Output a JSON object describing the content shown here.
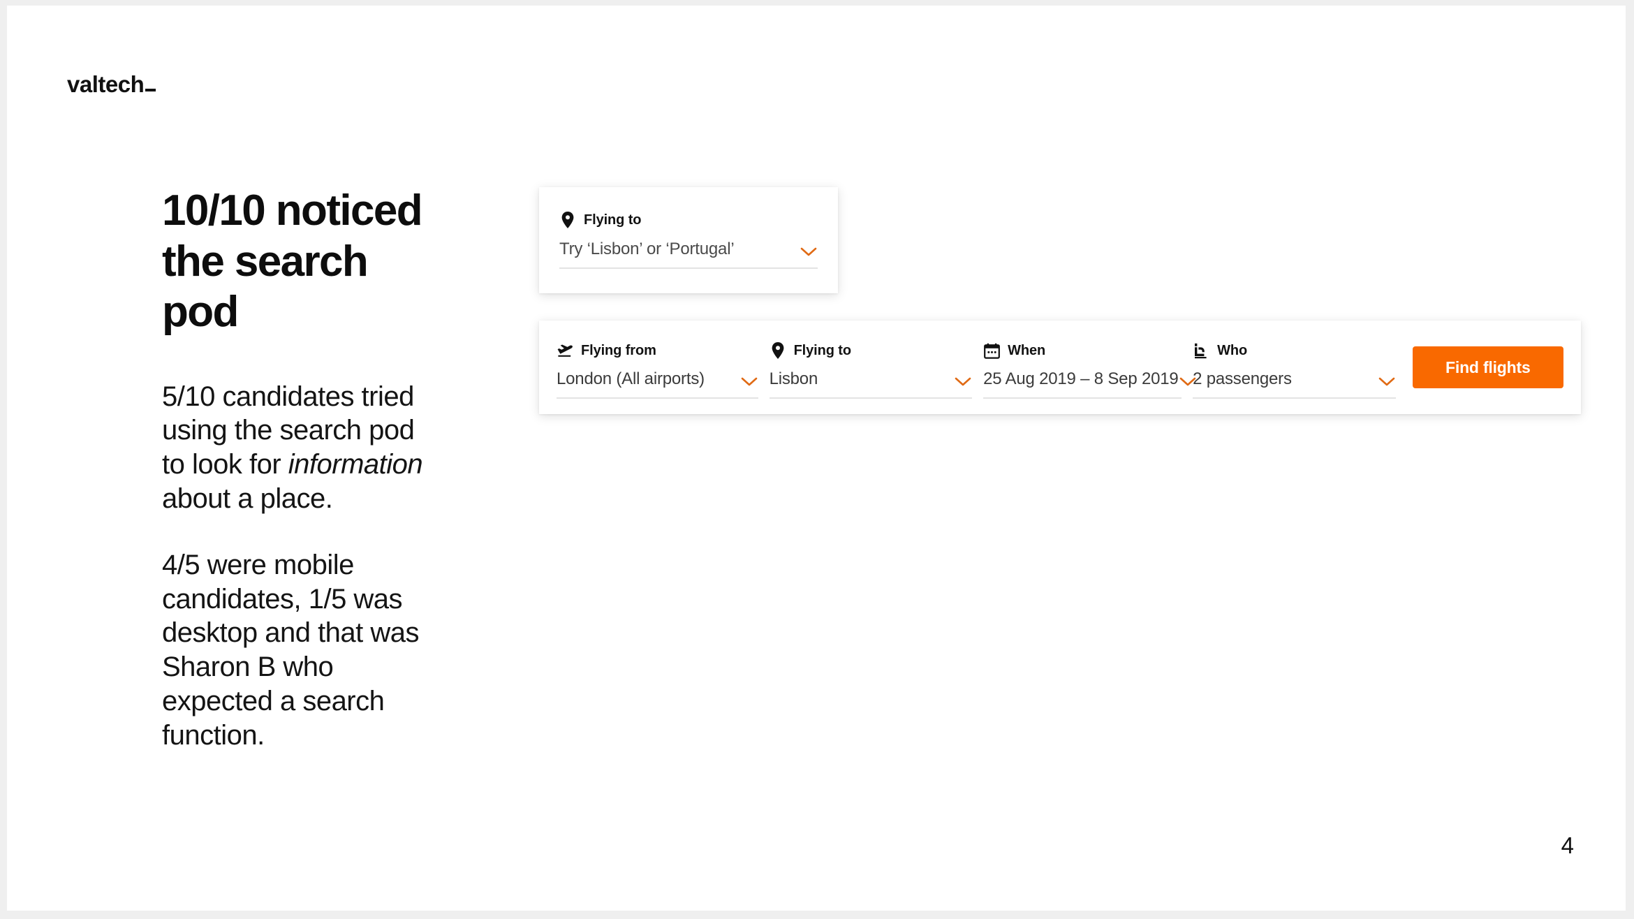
{
  "brand": {
    "logo_text": "valtech",
    "accent_color": "#f96900",
    "underline_color": "#e3e3e3"
  },
  "slide": {
    "page_number": "4",
    "headline": "10/10 noticed the search pod",
    "paragraphs": [
      {
        "before": "5/10 candidates tried using the search pod to look for ",
        "italic": "information",
        "after": " about a place."
      },
      {
        "before": "4/5 were mobile candidates, 1/5 was desktop and that was Sharon B who expected a search function.",
        "italic": "",
        "after": ""
      }
    ]
  },
  "flying_to_pod": {
    "icon": "map-pin-icon",
    "label": "Flying to",
    "placeholder": "Try ‘Lisbon’ or ‘Portugal’",
    "value": "Try ‘Lisbon’ or ‘Portugal’",
    "chevron": "chevron-down-icon"
  },
  "search_bar": {
    "fields": [
      {
        "icon": "plane-departure-icon",
        "label": "Flying from",
        "value": "London (All airports)",
        "chevron": "chevron-down-icon"
      },
      {
        "icon": "map-pin-icon",
        "label": "Flying to",
        "value": "Lisbon",
        "chevron": "chevron-down-icon"
      },
      {
        "icon": "calendar-icon",
        "label": "When",
        "value": "25 Aug 2019 – 8 Sep 2019",
        "chevron": "chevron-down-icon"
      },
      {
        "icon": "seat-icon",
        "label": "Who",
        "value": "2 passengers",
        "chevron": "chevron-down-icon"
      }
    ],
    "submit_label": "Find flights"
  }
}
